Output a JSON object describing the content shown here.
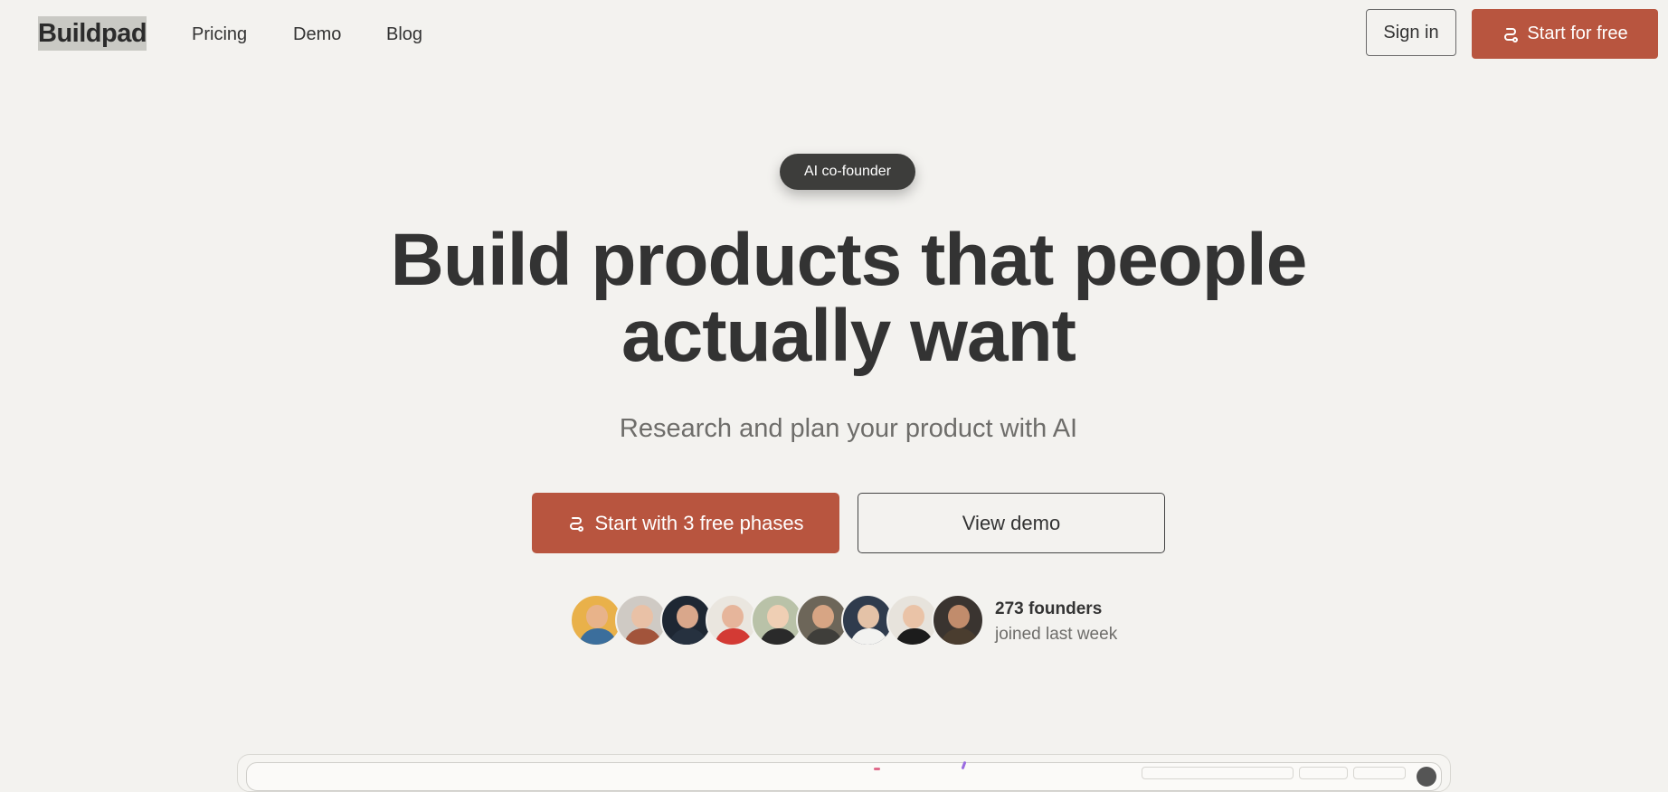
{
  "nav": {
    "logo": "Buildpad",
    "links": [
      "Pricing",
      "Demo",
      "Blog"
    ],
    "sign_in": "Sign in",
    "start_free": "Start for free"
  },
  "hero": {
    "badge": "AI co-founder",
    "headline_line1": "Build products that people",
    "headline_line2": "actually want",
    "subtitle": "Research and plan your product with AI",
    "cta_primary": "Start with 3 free phases",
    "cta_secondary": "View demo"
  },
  "social_proof": {
    "count": "273 founders",
    "text": "joined last week",
    "avatars": [
      {
        "skin": "#e8b38a",
        "shirt": "#3b6e9c",
        "bg": "#e9b14a"
      },
      {
        "skin": "#e9c1a6",
        "shirt": "#a2543b",
        "bg": "#cfcac4"
      },
      {
        "skin": "#d9a78b",
        "shirt": "#26313f",
        "bg": "#1e2733"
      },
      {
        "skin": "#e6b59b",
        "shirt": "#d33a34",
        "bg": "#eae6df"
      },
      {
        "skin": "#efcfb4",
        "shirt": "#2a2a2a",
        "bg": "#b9c2a8"
      },
      {
        "skin": "#d7a584",
        "shirt": "#3f3e3a",
        "bg": "#6d6659"
      },
      {
        "skin": "#e4c2a7",
        "shirt": "#f2f2f0",
        "bg": "#2f3b4d"
      },
      {
        "skin": "#eac3a7",
        "shirt": "#1c1c1c",
        "bg": "#e7e3dc"
      },
      {
        "skin": "#c18c6c",
        "shirt": "#4a3d2f",
        "bg": "#3a3430"
      }
    ]
  },
  "colors": {
    "accent": "#b8553f",
    "background": "#f3f2ef",
    "text": "#333333",
    "muted": "#6e6d6a"
  },
  "icons": {
    "cta": "link-icon"
  }
}
